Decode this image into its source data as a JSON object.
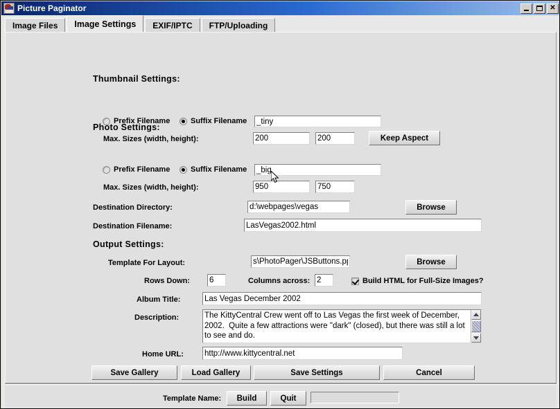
{
  "window": {
    "title": "Picture Paginator",
    "icon": "app-icon",
    "buttons": {
      "minimize": "minimize",
      "maximize": "maximize",
      "close": "close"
    }
  },
  "tabs": [
    {
      "label": "Image Files",
      "active": false
    },
    {
      "label": "Image Settings",
      "active": true
    },
    {
      "label": "EXIF/IPTC",
      "active": false
    },
    {
      "label": "FTP/Uploading",
      "active": false
    }
  ],
  "thumbnail": {
    "group_title": "Thumbnail Settings:",
    "prefix_label": "Prefix Filename",
    "suffix_label": "Suffix Filename",
    "prefix_selected": false,
    "suffix_selected": true,
    "affix_value": "_tiny",
    "max_sizes_label": "Max. Sizes (width, height):",
    "width_value": "200",
    "height_value": "200",
    "keep_aspect_label": "Keep Aspect"
  },
  "photo": {
    "group_title": "Photo Settings:",
    "prefix_label": "Prefix Filename",
    "suffix_label": "Suffix Filename",
    "prefix_selected": false,
    "suffix_selected": true,
    "affix_value": "_big",
    "max_sizes_label": "Max. Sizes (width, height):",
    "width_value": "950",
    "height_value": "750"
  },
  "destination": {
    "directory_label": "Destination Directory:",
    "directory_value": "d:\\webpages\\vegas",
    "directory_browse_label": "Browse",
    "filename_label": "Destination Filename:",
    "filename_value": "LasVegas2002.html"
  },
  "output": {
    "group_title": "Output Settings:",
    "template_label": "Template For Layout:",
    "template_value": "s\\PhotoPager\\JSButtons.ppg",
    "template_browse_label": "Browse",
    "rows_label": "Rows Down:",
    "rows_value": "6",
    "columns_label": "Columns across:",
    "columns_value": "2",
    "build_html_label": "Build HTML for Full-Size Images?",
    "build_html_checked": true,
    "album_title_label": "Album Title:",
    "album_title_value": "Las Vegas December 2002",
    "description_label": "Description:",
    "description_value": "The KittyCentral Crew went off to Las Vegas the first week of December, 2002.  Quite a few attractions were \"dark\" (closed), but there was still a lot to see and do.",
    "home_url_label": "Home URL:",
    "home_url_value": "http://www.kittycentral.net"
  },
  "actions": {
    "save_gallery": "Save Gallery",
    "load_gallery": "Load Gallery",
    "save_settings": "Save Settings",
    "cancel": "Cancel"
  },
  "statusbar": {
    "template_name_label": "Template Name:",
    "build_label": "Build",
    "quit_label": "Quit",
    "progress_value": ""
  },
  "colors": {
    "titlebar_start": "#0a246a",
    "titlebar_end": "#9fc0e8",
    "panel": "#e0e0e0",
    "tab_active": "#e8e8e8",
    "field": "#ffffff"
  }
}
